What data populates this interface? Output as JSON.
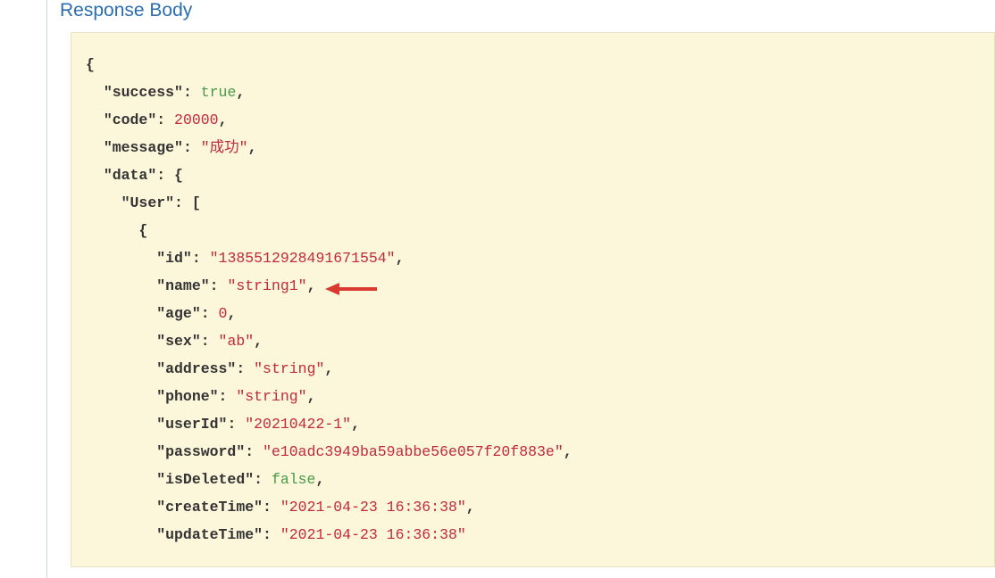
{
  "section_title": "Response Body",
  "json_response": {
    "success": {
      "key": "\"success\"",
      "value": "true",
      "type": "bool"
    },
    "code": {
      "key": "\"code\"",
      "value": "20000",
      "type": "number"
    },
    "message": {
      "key": "\"message\"",
      "value": "\"成功\"",
      "type": "string"
    },
    "data_key": "\"data\"",
    "user_key": "\"User\"",
    "user_fields": {
      "id": {
        "key": "\"id\"",
        "value": "\"1385512928491671554\"",
        "type": "string"
      },
      "name": {
        "key": "\"name\"",
        "value": "\"string1\"",
        "type": "string"
      },
      "age": {
        "key": "\"age\"",
        "value": "0",
        "type": "number"
      },
      "sex": {
        "key": "\"sex\"",
        "value": "\"ab\"",
        "type": "string"
      },
      "address": {
        "key": "\"address\"",
        "value": "\"string\"",
        "type": "string"
      },
      "phone": {
        "key": "\"phone\"",
        "value": "\"string\"",
        "type": "string"
      },
      "userId": {
        "key": "\"userId\"",
        "value": "\"20210422-1\"",
        "type": "string"
      },
      "password": {
        "key": "\"password\"",
        "value": "\"e10adc3949ba59abbe56e057f20f883e\"",
        "type": "string"
      },
      "isDeleted": {
        "key": "\"isDeleted\"",
        "value": "false",
        "type": "bool"
      },
      "createTime": {
        "key": "\"createTime\"",
        "value": "\"2021-04-23 16:36:38\"",
        "type": "string"
      },
      "updateTime": {
        "key": "\"updateTime\"",
        "value": "\"2021-04-23 16:36:38\"",
        "type": "string"
      }
    }
  },
  "annotation": {
    "arrow_target": "age_field",
    "arrow_color": "#d83a2f"
  }
}
